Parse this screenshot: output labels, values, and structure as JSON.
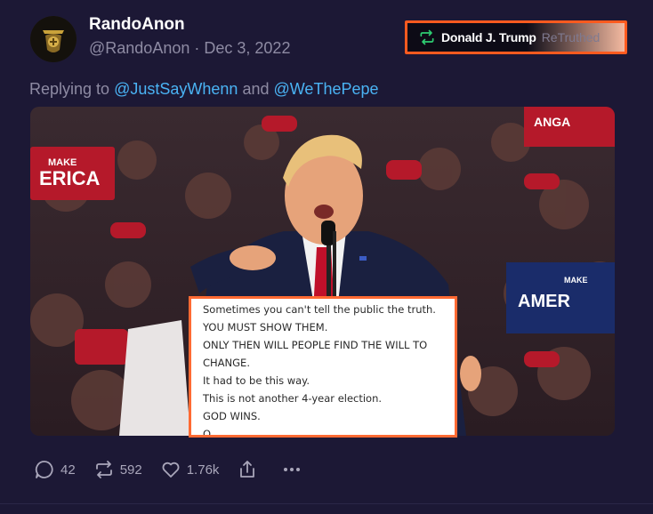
{
  "post": {
    "display_name": "RandoAnon",
    "handle": "@RandoAnon",
    "separator": "·",
    "date": "Dec 3, 2022",
    "avatar_icon": "gold-emblem-avatar"
  },
  "retruth": {
    "icon": "retruth-icon",
    "name": "Donald J. Trump",
    "label": "ReTruthed",
    "accent_color": "#2ecc71",
    "border_color": "#ff5a1f"
  },
  "replying": {
    "prefix": "Replying to",
    "mention1": "@JustSayWhenn",
    "conjunction": "and",
    "mention2": "@WeThePepe"
  },
  "media": {
    "caption_lines": [
      "Sometimes you can't tell the public the truth.",
      "YOU MUST SHOW THEM.",
      "ONLY THEN WILL PEOPLE FIND THE WILL TO",
      "CHANGE.",
      "It had to be this way.",
      "This is not another 4-year election.",
      "GOD WINS.",
      "Q"
    ],
    "caption_border_color": "#ff6a33"
  },
  "actions": {
    "replies": "42",
    "retruths": "592",
    "likes": "1.76k",
    "reply_icon": "comment-icon",
    "retruth_icon": "retruth-icon",
    "like_icon": "heart-icon",
    "share_icon": "share-icon",
    "more_icon": "more-icon"
  }
}
